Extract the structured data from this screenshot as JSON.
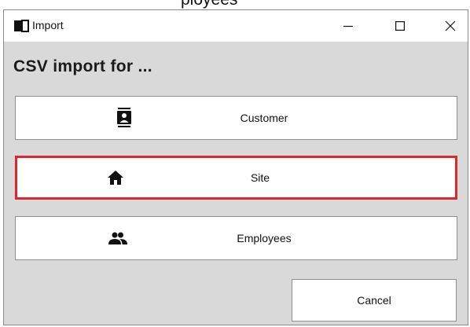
{
  "background_text": "ployees",
  "window": {
    "title": "Import",
    "icon": "book-icon",
    "controls": {
      "minimize_icon": "minimize-icon",
      "maximize_icon": "maximize-icon",
      "close_icon": "close-icon"
    }
  },
  "heading": "CSV import for ...",
  "options": [
    {
      "label": "Customer",
      "icon": "contact-card-icon",
      "selected": false
    },
    {
      "label": "Site",
      "icon": "home-icon",
      "selected": true
    },
    {
      "label": "Employees",
      "icon": "people-icon",
      "selected": false
    }
  ],
  "cancel_label": "Cancel",
  "colors": {
    "selection_border": "#e0252f",
    "dialog_background": "#d9d9d9",
    "button_background": "#ffffff"
  }
}
